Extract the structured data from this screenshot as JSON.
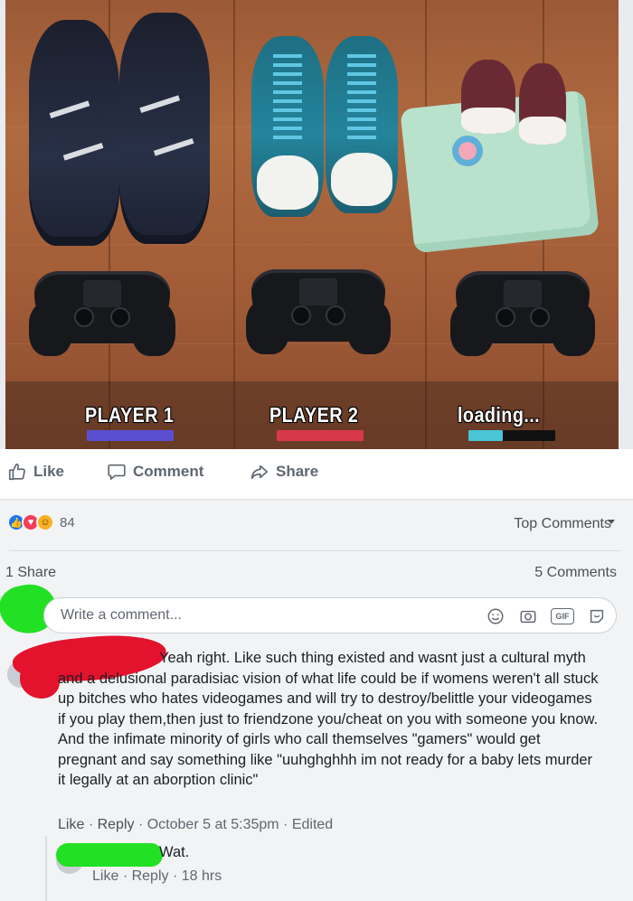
{
  "photo": {
    "labels": [
      "PLAYER 1",
      "PLAYER 2",
      "loading..."
    ],
    "bar_colors": [
      "#5a4fd0",
      "#d8394a",
      "#48c6d8"
    ],
    "loading_progress": 0.4
  },
  "actions": {
    "like_label": "Like",
    "comment_label": "Comment",
    "share_label": "Share"
  },
  "feedback": {
    "reaction_icons": [
      "like-icon",
      "love-icon",
      "haha-icon"
    ],
    "reaction_count": "84",
    "sort_label": "Top Comments",
    "shares": "1 Share",
    "comments": "5 Comments"
  },
  "composer": {
    "placeholder": "Write a comment...",
    "icons": [
      "emoji-icon",
      "camera-icon",
      "gif-icon",
      "sticker-icon"
    ],
    "gif_label": "GIF"
  },
  "comment": {
    "text": "Yeah right. Like such thing existed and wasnt just a cultural myth and a delusional paradisiac vision of what life could be if womens weren't all stuck up bitches who hates videogames and will try to destroy/belittle your videogames if you play them,then just to friendzone you/cheat on you with someone you know. And the infimate minority of girls who call themselves \"gamers\" would get pregnant and say something like \"uuhghghhh im not ready for a baby lets murder it legally at an aborption clinic\"",
    "like": "Like",
    "reply": "Reply",
    "timestamp": "October 5 at 5:35pm",
    "edited": "Edited",
    "sep": "·"
  },
  "reply": {
    "text": "Wat.",
    "like": "Like",
    "reply": "Reply",
    "timestamp": "18 hrs",
    "sep": "·"
  },
  "colors": {
    "facebook_blue": "#1877f2",
    "redaction_green": "#22e024",
    "redaction_red": "#e3122d"
  }
}
